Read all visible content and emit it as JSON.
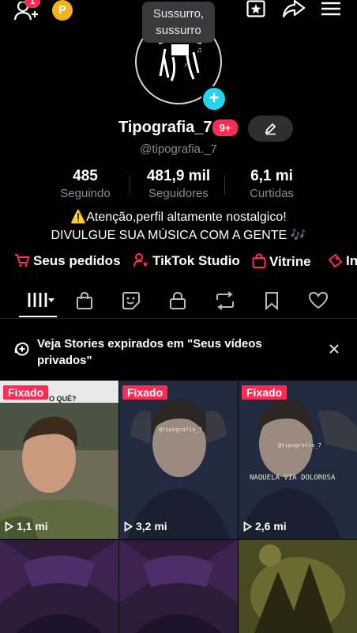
{
  "header": {
    "friend_badge": "1",
    "coin_label": "P",
    "tooltip_line1": "Sussurro,",
    "tooltip_line2": "sussurro"
  },
  "profile": {
    "display_name": "Tipografia_7",
    "notif_badge": "9+",
    "handle": "@tipografia._7",
    "stats": [
      {
        "value": "485",
        "label": "Seguindo"
      },
      {
        "value": "481,9 mil",
        "label": "Seguidores"
      },
      {
        "value": "6,1 mi",
        "label": "Curtidas"
      }
    ],
    "bio_line1": "⚠️Atenção,perfil altamente nostalgico!",
    "bio_line2": "DIVULGUE SUA MÚSICA COM A GENTE 🎶"
  },
  "quick_links": [
    {
      "label": "Seus pedidos",
      "icon": "cart-icon"
    },
    {
      "label": "TikTok Studio",
      "icon": "studio-person-icon"
    },
    {
      "label": "Vitrine",
      "icon": "shopping-bag-icon"
    },
    {
      "label": "In",
      "icon": "gift-icon"
    }
  ],
  "tabs": [
    "grid-icon",
    "bag-icon",
    "sticker-icon",
    "lock-icon",
    "repost-icon",
    "bookmark-icon",
    "heart-icon"
  ],
  "banner": {
    "text": "Veja Stories expirados em \"Seus vídeos privados\""
  },
  "videos": [
    {
      "pinned": "Fixado",
      "views": "1,1 mi",
      "caption": "O QUÊ?"
    },
    {
      "pinned": "Fixado",
      "views": "3,2 mi",
      "caption": "@tipografia_7"
    },
    {
      "pinned": "Fixado",
      "views": "2,6 mi",
      "caption": "@tipografia_7",
      "caption2": "NAQUELA VIA DOLOROSA"
    }
  ],
  "colors": {
    "accent": "#fe2c55",
    "plus": "#20d5ec",
    "secondary_text": "#8a8a8a"
  }
}
